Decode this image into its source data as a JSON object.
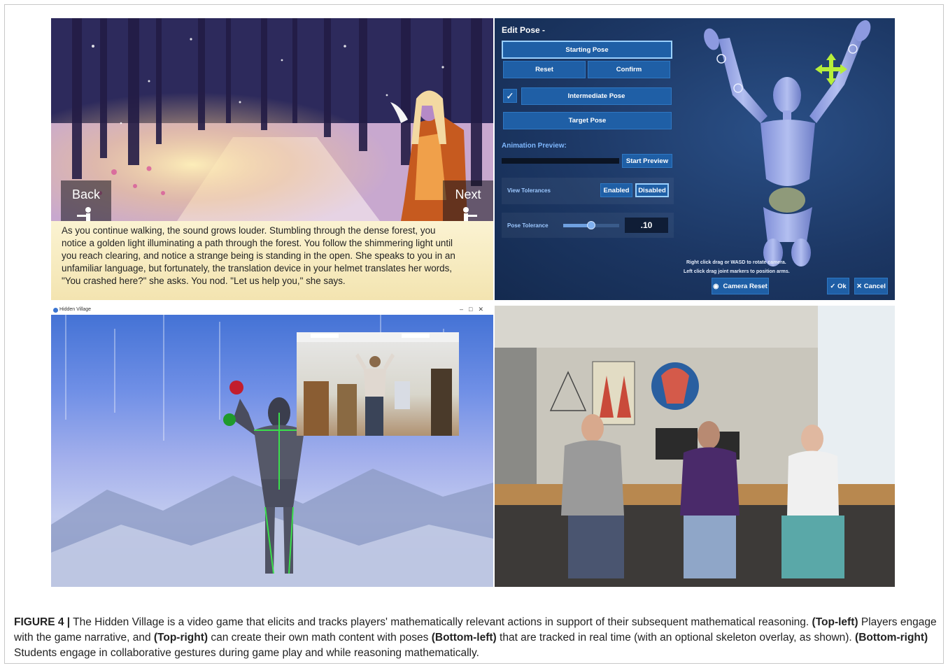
{
  "top_left": {
    "back_label": "Back",
    "next_label": "Next",
    "story_lines": [
      "As you continue walking, the sound grows louder.  Stumbling through the dense forest, you",
      "notice a golden light illuminating a path through the forest. You follow the shimmering light until",
      "you reach clearing, and notice a strange being is standing in the open.  She speaks to you in an",
      "unfamiliar language, but fortunately, the translation device in your helmet translates her words,",
      "\"You crashed here?\" she asks. You nod. \"Let us help you,\" she says."
    ]
  },
  "top_right": {
    "title": "Edit Pose -",
    "starting_pose": "Starting Pose",
    "reset": "Reset",
    "confirm": "Confirm",
    "intermediate_pose": "Intermediate Pose",
    "target_pose": "Target Pose",
    "animation_preview": "Animation Preview:",
    "start_preview": "Start Preview",
    "view_tolerances": "View Tolerances",
    "enabled": "Enabled",
    "disabled": "Disabled",
    "pose_tolerance": "Pose Tolerance",
    "pose_tolerance_value": ".10",
    "hint_line1": "Right click drag or WASD to rotate camera.",
    "hint_line2": "Left click drag joint markers to position arms.",
    "camera_reset": "Camera Reset",
    "ok": "✓ Ok",
    "cancel": "✕ Cancel",
    "colors": {
      "panel": "#1c3764",
      "button": "#1f5fa6",
      "accent": "#9ad0ff"
    }
  },
  "bottom_left": {
    "window_title": "Hidden Village"
  },
  "caption": {
    "figure_label": "FIGURE 4 |",
    "t1": " The Hidden Village is a video game that elicits and tracks players' mathematically relevant actions in support of their subsequent mathematical reasoning. ",
    "k1": "(Top-left)",
    "t2": " Players engage with the game narrative, and ",
    "k2": "(Top-right)",
    "t3": " can create their own math content with poses ",
    "k3": "(Bottom-left)",
    "t4": " that are tracked in real time (with an optional skeleton overlay, as shown). ",
    "k4": "(Bottom-right)",
    "t5": " Students engage in collaborative gestures during game play and while reasoning mathematically."
  }
}
